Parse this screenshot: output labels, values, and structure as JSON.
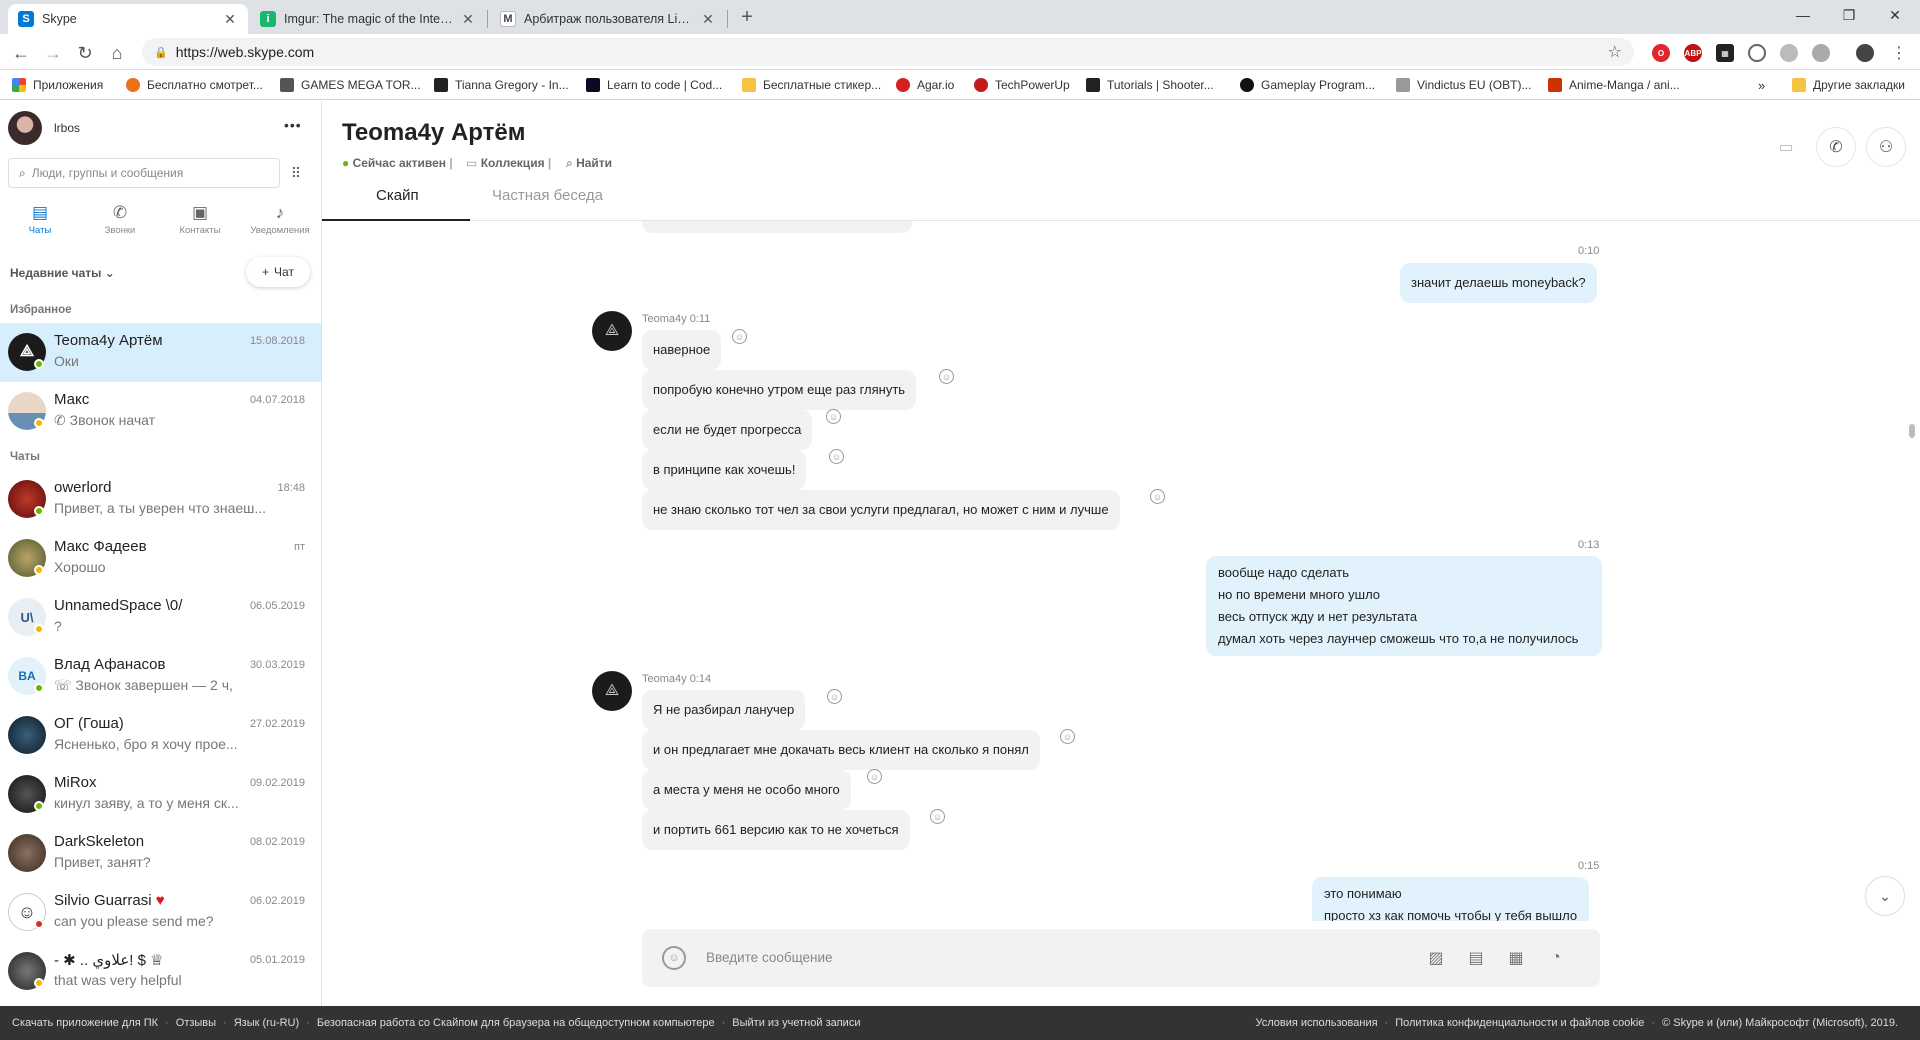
{
  "browser": {
    "tabs": [
      {
        "title": "Skype",
        "icon": "skype-icon",
        "active": true
      },
      {
        "title": "Imgur: The magic of the Internet",
        "icon": "imgur-icon",
        "active": false
      },
      {
        "title": "Арбитраж пользователя LightF...",
        "icon": "m-icon",
        "active": false
      }
    ],
    "new_tab": "+",
    "url": "https://web.skype.com",
    "bookmarks": [
      {
        "label": "Приложения",
        "color": "#4285f4"
      },
      {
        "label": "Бесплатно смотрет...",
        "color": "#e8711a"
      },
      {
        "label": "GAMES MEGA TOR...",
        "color": "#555555"
      },
      {
        "label": "Tianna Gregory - In...",
        "color": "#222222"
      },
      {
        "label": "Learn to code | Cod...",
        "color": "#0a0a23"
      },
      {
        "label": "Бесплатные стикер...",
        "color": "#f5c342"
      },
      {
        "label": "Agar.io",
        "color": "#d61f1f"
      },
      {
        "label": "TechPowerUp",
        "color": "#c41a1a"
      },
      {
        "label": "Tutorials | Shooter...",
        "color": "#222222"
      },
      {
        "label": "Gameplay Program...",
        "color": "#111111"
      },
      {
        "label": "Vindictus EU (OBT)...",
        "color": "#999999"
      },
      {
        "label": "Anime-Manga / ani...",
        "color": "#cc3300"
      }
    ],
    "bookmarks_more": "»",
    "other_bookmarks": "Другие закладки"
  },
  "sidebar": {
    "username": "lrbos",
    "more": "•••",
    "search_placeholder": "Люди, группы и сообщения",
    "nav": [
      {
        "label": "Чаты",
        "icon": "chat-icon"
      },
      {
        "label": "Звонки",
        "icon": "phone-icon"
      },
      {
        "label": "Контакты",
        "icon": "contacts-icon"
      },
      {
        "label": "Уведомления",
        "icon": "bell-icon"
      }
    ],
    "recent_label": "Недавние чаты",
    "new_chat_label": "Чат",
    "favorites_label": "Избранное",
    "chats_label": "Чаты",
    "favorites": [
      {
        "name": "Teoma4y Артём",
        "preview": "Оки",
        "date": "15.08.2018"
      },
      {
        "name": "Макс",
        "preview": "Звонок начат",
        "date": "04.07.2018"
      }
    ],
    "chats": [
      {
        "name": "owerlord",
        "preview": "Привет, а ты уверен что знаеш...",
        "date": "18:48"
      },
      {
        "name": "Макс Фадеев",
        "preview": "Хорошо",
        "date": "пт"
      },
      {
        "name": "UnnamedSpace \\0/",
        "preview": "?",
        "date": "06.05.2019",
        "initials": "U\\"
      },
      {
        "name": "Влад Афанасов",
        "preview": "Звонок завершен — 2 ч,",
        "date": "30.03.2019",
        "initials": "BA"
      },
      {
        "name": "ОГ (Гоша)",
        "preview": "Ясненько, бро я хочу прое...",
        "date": "27.02.2019"
      },
      {
        "name": "MiRox",
        "preview": "кинул заяву, а то у меня ск...",
        "date": "09.02.2019"
      },
      {
        "name": "DarkSkeleton",
        "preview": "Привет, занят?",
        "date": "08.02.2019"
      },
      {
        "name": "Silvio Guarrasi",
        "preview": "can you please send me?",
        "date": "06.02.2019"
      },
      {
        "name": "- ✱ .. علاوي! $ ♕",
        "preview": "that was very helpful",
        "date": "05.01.2019"
      }
    ]
  },
  "chat": {
    "title": "Teoma4y Артём",
    "status": "Сейчас активен",
    "gallery": "Коллекция",
    "find": "Найти",
    "tabs": [
      "Скайп",
      "Частная беседа"
    ],
    "groups": [
      {
        "time": "0:10",
        "dir": "out",
        "lines": [
          "значит делаешь moneyback?"
        ]
      },
      {
        "sender": "Teoma4y 0:11",
        "dir": "in",
        "msgs": [
          "наверное",
          "попробую конечно утром еще раз глянуть",
          "если не будет прогресса",
          "в принципе как хочешь!",
          "не знаю сколько тот чел за свои услуги предлагал, но может с  ним и лучше"
        ]
      },
      {
        "time": "0:13",
        "dir": "out",
        "lines": [
          "вообще надо сделать",
          "но по времени много ушло",
          "весь отпуск жду и нет результата",
          "думал хоть через лаунчер сможешь что то,а не получилось"
        ]
      },
      {
        "sender": "Teoma4y 0:14",
        "dir": "in",
        "msgs": [
          "Я не разбирал ланучер",
          "и он предлагает мне докачать весь клиент на сколько я понял",
          "а места у меня не особо много",
          "и портить 661 версию как то не хочеться"
        ]
      },
      {
        "time": "0:15",
        "dir": "out",
        "lines": [
          "это понимаю",
          "просто хз как помочь чтобы у тебя вышло"
        ]
      }
    ],
    "composer_placeholder": "Введите сообщение"
  },
  "footer": {
    "left": [
      "Скачать приложение для ПК",
      "Отзывы",
      "Язык (ru-RU)",
      "Безопасная работа со Скайпом для браузера на общедоступном компьютере",
      "Выйти из учетной записи"
    ],
    "right": [
      "Условия использования",
      "Политика конфиденциальности и файлов cookie",
      "© Skype и (или) Майкрософт (Microsoft), 2019."
    ]
  }
}
